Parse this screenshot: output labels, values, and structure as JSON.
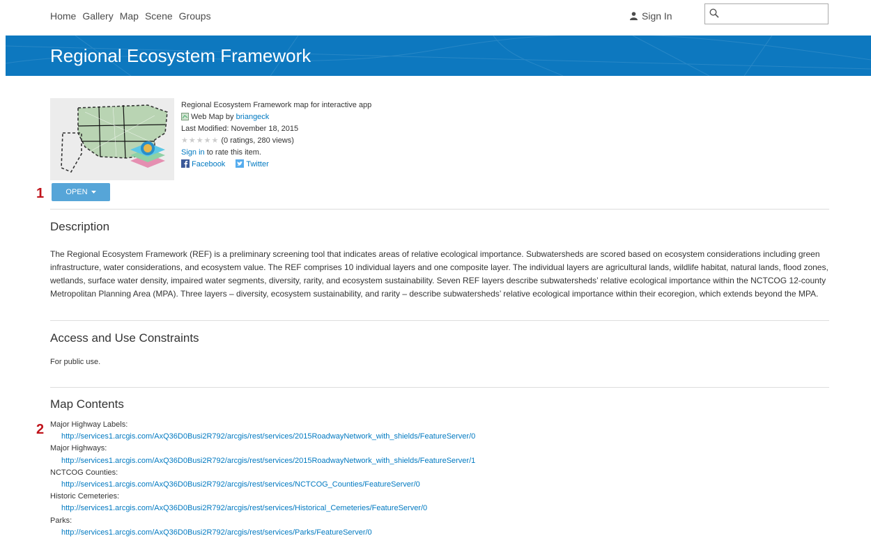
{
  "nav": {
    "links": [
      "Home",
      "Gallery",
      "Map",
      "Scene",
      "Groups"
    ],
    "sign_in": "Sign In",
    "search_placeholder": ""
  },
  "banner": {
    "title": "Regional Ecosystem Framework",
    "background_color": "#0d78bf"
  },
  "item": {
    "summary": "Regional Ecosystem Framework map for interactive app",
    "type_prefix": "Web Map by ",
    "owner": "briangeck",
    "last_modified": "Last Modified: November 18, 2015",
    "rating_stars": "★★★★★",
    "rating_text": "(0 ratings, 280 views)",
    "sign_in_link": "Sign in",
    "rate_text": " to rate this item.",
    "share_facebook": "Facebook",
    "share_twitter": "Twitter",
    "open_button": "OPEN"
  },
  "annotations": {
    "marker1": "1",
    "marker2": "2",
    "color": "#c0141c"
  },
  "description": {
    "heading": "Description",
    "text": "The Regional Ecosystem Framework (REF) is a preliminary screening tool that indicates areas of relative ecological importance. Subwatersheds are scored based on ecosystem considerations including green infrastructure, water considerations, and ecosystem value. The REF comprises 10 individual layers and one composite layer. The individual layers are agricultural lands, wildlife habitat, natural lands, flood zones, wetlands, surface water density, impaired water segments, diversity, rarity, and ecosystem sustainability. Seven REF layers describe subwatersheds’ relative ecological importance within the NCTCOG 12-county Metropolitan Planning Area (MPA). Three layers – diversity, ecosystem sustainability, and rarity – describe subwatersheds’ relative ecological importance within their ecoregion, which extends beyond the MPA."
  },
  "access": {
    "heading": "Access and Use Constraints",
    "text": "For public use."
  },
  "map_contents": {
    "heading": "Map Contents",
    "layers": [
      {
        "name": "Major Highway Labels:",
        "url": "http://services1.arcgis.com/AxQ36D0Busi2R792/arcgis/rest/services/2015RoadwayNetwork_with_shields/FeatureServer/0"
      },
      {
        "name": "Major Highways:",
        "url": "http://services1.arcgis.com/AxQ36D0Busi2R792/arcgis/rest/services/2015RoadwayNetwork_with_shields/FeatureServer/1"
      },
      {
        "name": "NCTCOG Counties:",
        "url": "http://services1.arcgis.com/AxQ36D0Busi2R792/arcgis/rest/services/NCTCOG_Counties/FeatureServer/0"
      },
      {
        "name": "Historic Cemeteries:",
        "url": "http://services1.arcgis.com/AxQ36D0Busi2R792/arcgis/rest/services/Historical_Cemeteries/FeatureServer/0"
      },
      {
        "name": "Parks:",
        "url": "http://services1.arcgis.com/AxQ36D0Busi2R792/arcgis/rest/services/Parks/FeatureServer/0"
      }
    ]
  },
  "colors": {
    "link": "#0079c1",
    "open_button": "#56a5d8",
    "divider": "#dddddd"
  }
}
